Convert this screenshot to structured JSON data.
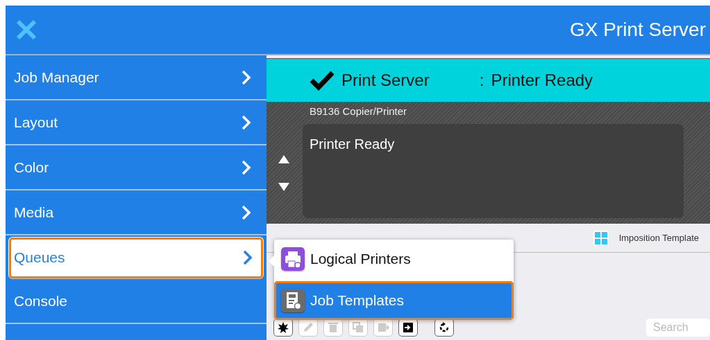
{
  "header": {
    "title": "GX Print Server"
  },
  "sidebar": {
    "items": [
      {
        "label": "Job Manager",
        "selected": false,
        "has_submenu": true
      },
      {
        "label": "Layout",
        "selected": false,
        "has_submenu": true
      },
      {
        "label": "Color",
        "selected": false,
        "has_submenu": true
      },
      {
        "label": "Media",
        "selected": false,
        "has_submenu": true
      },
      {
        "label": "Queues",
        "selected": true,
        "has_submenu": true
      },
      {
        "label": "Console",
        "selected": false,
        "has_submenu": false
      }
    ]
  },
  "status_bar": {
    "name": "Print Server",
    "separator": ":",
    "status": "Printer Ready",
    "ok": true
  },
  "printer_panel": {
    "device": "B9136 Copier/Printer",
    "message": "Printer Ready"
  },
  "tabs": [
    {
      "label": "Imposition Template"
    }
  ],
  "toolbar": {
    "buttons": [
      {
        "kind": "new",
        "disabled": false
      },
      {
        "kind": "edit",
        "disabled": true
      },
      {
        "kind": "delete",
        "disabled": true
      },
      {
        "kind": "duplicate",
        "disabled": true
      },
      {
        "kind": "move",
        "disabled": true
      },
      {
        "kind": "import",
        "disabled": false
      },
      {
        "kind": "refresh",
        "disabled": false
      }
    ],
    "search": {
      "placeholder": "Search"
    }
  },
  "submenu": {
    "items": [
      {
        "label": "Logical Printers",
        "kind": "printer",
        "selected": false
      },
      {
        "label": "Job Templates",
        "kind": "template",
        "selected": true
      }
    ]
  }
}
